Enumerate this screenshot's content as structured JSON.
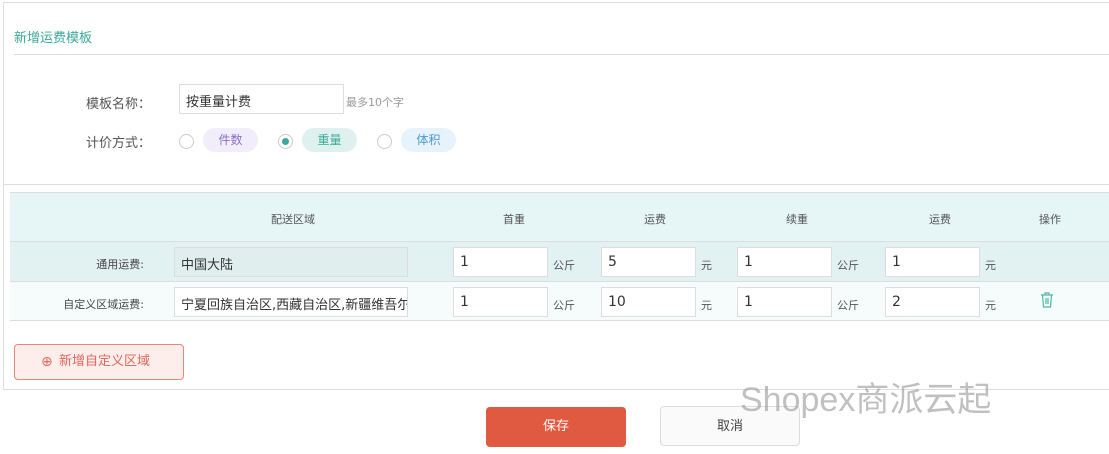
{
  "title": "新增运费模板",
  "form": {
    "name_label": "模板名称：",
    "name_value": "按重量计费",
    "name_hint": "最多10个字",
    "method_label": "计价方式：",
    "methods": [
      {
        "label": "件数",
        "selected": false,
        "color": "#8a6fc9",
        "bg": "#f1edfb"
      },
      {
        "label": "重量",
        "selected": true,
        "color": "#3aa99a",
        "bg": "#dff1ee"
      },
      {
        "label": "体积",
        "selected": false,
        "color": "#4a9bd6",
        "bg": "#e6f3fc"
      }
    ]
  },
  "table": {
    "headers": [
      "配送区域",
      "首重",
      "运费",
      "续重",
      "运费",
      "操作"
    ],
    "rows": [
      {
        "label": "通用运费:",
        "area": "中国大陆",
        "first": "1",
        "first_unit": "公斤",
        "fee": "5",
        "fee_unit": "元",
        "cont": "1",
        "cont_unit": "公斤",
        "cfee": "1",
        "cfee_unit": "元"
      },
      {
        "label": "自定义区域运费:",
        "area": "宁夏回族自治区,西藏自治区,新疆维吾尔自治区",
        "first": "1",
        "first_unit": "公斤",
        "fee": "10",
        "fee_unit": "元",
        "cont": "1",
        "cont_unit": "公斤",
        "cfee": "2",
        "cfee_unit": "元"
      }
    ]
  },
  "add_region": "新增自定义区域",
  "save": "保存",
  "cancel": "取消",
  "watermark": "Shopex商派云起"
}
